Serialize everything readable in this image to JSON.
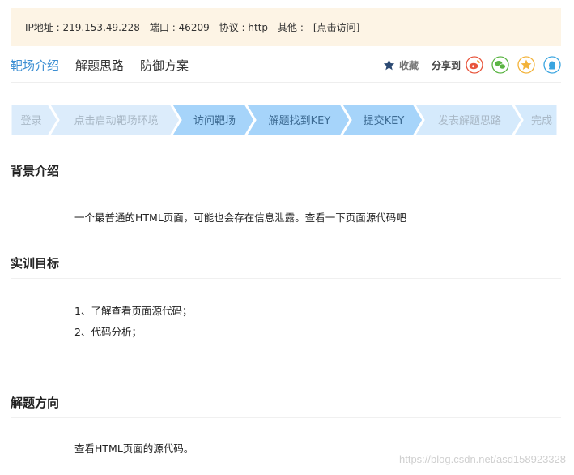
{
  "info": {
    "ip": "IP地址 : 219.153.49.228",
    "port": "端口 : 46209",
    "protocol": "协议 : http",
    "other_label": "其他 :",
    "visit_link": "[点击访问]"
  },
  "tabs": [
    {
      "label": "靶场介绍",
      "active": true
    },
    {
      "label": "解题思路",
      "active": false
    },
    {
      "label": "防御方案",
      "active": false
    }
  ],
  "tools": {
    "favorite": "收藏",
    "share": "分享到",
    "icons": [
      "weibo-icon",
      "wechat-icon",
      "qzone-icon",
      "qq-icon"
    ]
  },
  "steps": [
    {
      "label": "登录",
      "state": "done"
    },
    {
      "label": "点击启动靶场环境",
      "state": "done"
    },
    {
      "label": "访问靶场",
      "state": "active"
    },
    {
      "label": "解题找到KEY",
      "state": "active"
    },
    {
      "label": "提交KEY",
      "state": "active"
    },
    {
      "label": "发表解题思路",
      "state": "pending"
    },
    {
      "label": "完成",
      "state": "pending"
    }
  ],
  "colors": {
    "step_done": "#dcecfb",
    "step_active": "#a6d4fa",
    "step_pending": "#d5eafc",
    "tab_active": "#3d8fd3"
  },
  "sections": {
    "background": {
      "title": "背景介绍",
      "text": "一个最普通的HTML页面，可能也会存在信息泄露。查看一下页面源代码吧"
    },
    "goals": {
      "title": "实训目标",
      "items": [
        "1、了解查看页面源代码；",
        "2、代码分析；"
      ]
    },
    "direction": {
      "title": "解题方向",
      "text": "查看HTML页面的源代码。"
    }
  },
  "watermark": "https://blog.csdn.net/asd158923328"
}
